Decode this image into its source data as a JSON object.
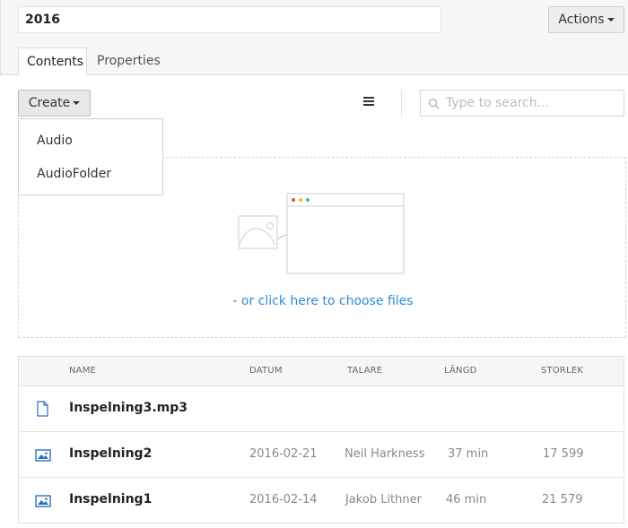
{
  "header": {
    "name_value": "2016",
    "actions_label": "Actions"
  },
  "tabs": [
    {
      "label": "Contents",
      "active": true
    },
    {
      "label": "Properties",
      "active": false
    }
  ],
  "toolbar": {
    "create_label": "Create",
    "create_menu": [
      "Audio",
      "AudioFolder"
    ],
    "search_placeholder": "Type to search..."
  },
  "dropzone": {
    "link_text": "- or click here to choose files"
  },
  "table": {
    "columns": [
      "NAME",
      "DATUM",
      "TALARE",
      "LÄNGD",
      "STORLEK"
    ],
    "rows": [
      {
        "icon": "file-icon",
        "name": "Inspelning3.mp3",
        "datum": "",
        "talare": "",
        "langd": "",
        "storlek": ""
      },
      {
        "icon": "image-icon",
        "name": "Inspelning2",
        "datum": "2016-02-21",
        "talare": "Neil Harkness",
        "langd": "37 min",
        "storlek": "17 599"
      },
      {
        "icon": "image-icon",
        "name": "Inspelning1",
        "datum": "2016-02-14",
        "talare": "Jakob Lithner",
        "langd": "46 min",
        "storlek": "21 579"
      }
    ]
  },
  "colors": {
    "link": "#2e8ad8",
    "icon_blue": "#2e6fc0"
  }
}
